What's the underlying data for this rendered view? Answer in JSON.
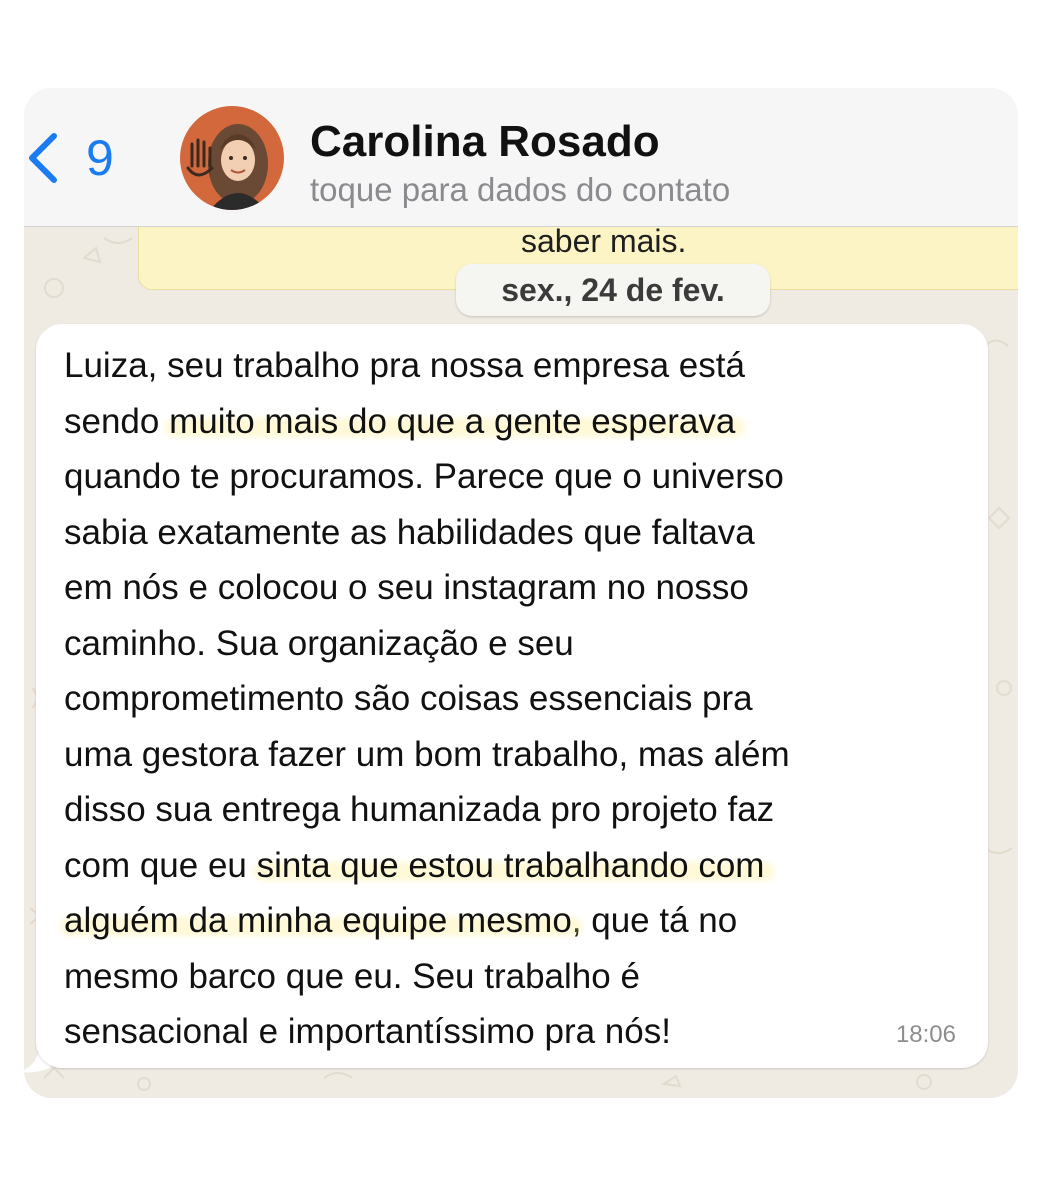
{
  "header": {
    "back_count": "9",
    "contact_name": "Carolina Rosado",
    "contact_subtitle": "toque para dados do contato",
    "avatar_icon": "profile-photo-icon"
  },
  "banner": {
    "text": "saber mais."
  },
  "date_separator": "sex., 24 de fev.",
  "message": {
    "lines": [
      {
        "a": "Luiza, seu trabalho pra nossa empresa está",
        "h": "",
        "b": ""
      },
      {
        "a": "sendo ",
        "h": "muito mais do que a gente esperava",
        "b": ""
      },
      {
        "a": "quando te procuramos. Parece que o universo",
        "h": "",
        "b": ""
      },
      {
        "a": "sabia exatamente as habilidades que faltava",
        "h": "",
        "b": ""
      },
      {
        "a": "em nós e colocou o seu instagram no nosso",
        "h": "",
        "b": ""
      },
      {
        "a": "caminho. Sua organização e seu",
        "h": "",
        "b": ""
      },
      {
        "a": "comprometimento são coisas essenciais pra",
        "h": "",
        "b": ""
      },
      {
        "a": "uma gestora fazer um bom trabalho, mas além",
        "h": "",
        "b": ""
      },
      {
        "a": "disso sua entrega humanizada pro projeto faz",
        "h": "",
        "b": ""
      },
      {
        "a": "com que eu ",
        "h": "sinta que estou trabalhando com",
        "b": ""
      },
      {
        "a": "",
        "h": "alguém da minha equipe mesmo",
        "b": ", que tá no"
      },
      {
        "a": "mesmo barco que eu. Seu trabalho é",
        "h": "",
        "b": ""
      },
      {
        "a": "sensacional e importantíssimo pra nós!",
        "h": "",
        "b": ""
      }
    ],
    "time": "18:06"
  },
  "colors": {
    "accent_blue": "#1b7cf2",
    "chat_background": "#efeae2",
    "highlight": "#ffe86e",
    "banner_yellow": "#fdf4c5"
  }
}
